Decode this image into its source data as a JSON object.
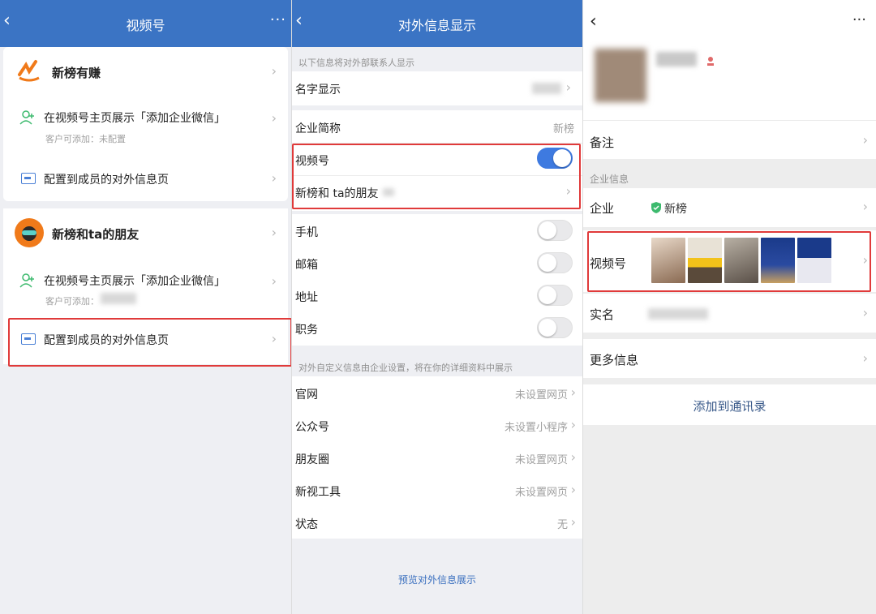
{
  "panel1": {
    "nav": {
      "title": "视频号"
    },
    "accounts": [
      {
        "name": "新榜有赚",
        "display_text": "在视频号主页展示「添加企业微信」",
        "sub_text": "客户可添加：未配置",
        "config_text": "配置到成员的对外信息页"
      },
      {
        "name": "新榜和ta的朋友",
        "display_text": "在视频号主页展示「添加企业微信」",
        "sub_text": "客户可添加：",
        "config_text": "配置到成员的对外信息页"
      }
    ]
  },
  "panel2": {
    "nav": {
      "title": "对外信息显示"
    },
    "section_header": "以下信息将对外部联系人显示",
    "rows": {
      "name_display": "名字显示",
      "company_short_label": "企业简称",
      "company_short_value": "新榜",
      "channels_label": "视频号",
      "channels_account": "新榜和 ta的朋友",
      "phone": "手机",
      "email": "邮箱",
      "address": "地址",
      "position": "职务"
    },
    "custom_header": "对外自定义信息由企业设置，将在你的详细资料中展示",
    "custom_rows": [
      {
        "label": "官网",
        "value": "未设置网页"
      },
      {
        "label": "公众号",
        "value": "未设置小程序"
      },
      {
        "label": "朋友圈",
        "value": "未设置网页"
      },
      {
        "label": "新视工具",
        "value": "未设置网页"
      },
      {
        "label": "状态",
        "value": "无"
      }
    ],
    "preview_link": "预览对外信息展示",
    "toggles": {
      "channels": true,
      "phone": false,
      "email": false,
      "address": false,
      "position": false
    }
  },
  "panel3": {
    "remark_label": "备注",
    "company_section": "企业信息",
    "company_label": "企业",
    "company_value": "新榜",
    "channels_label": "视频号",
    "realname_label": "实名",
    "more_info_label": "更多信息",
    "add_contact": "添加到通讯录"
  },
  "colors": {
    "nav_blue": "#3b74c4",
    "toggle_on": "#3e7ae0",
    "highlight_red": "#e03a3a",
    "link_blue": "#3a6fbf",
    "verified_green": "#3dba6e"
  }
}
